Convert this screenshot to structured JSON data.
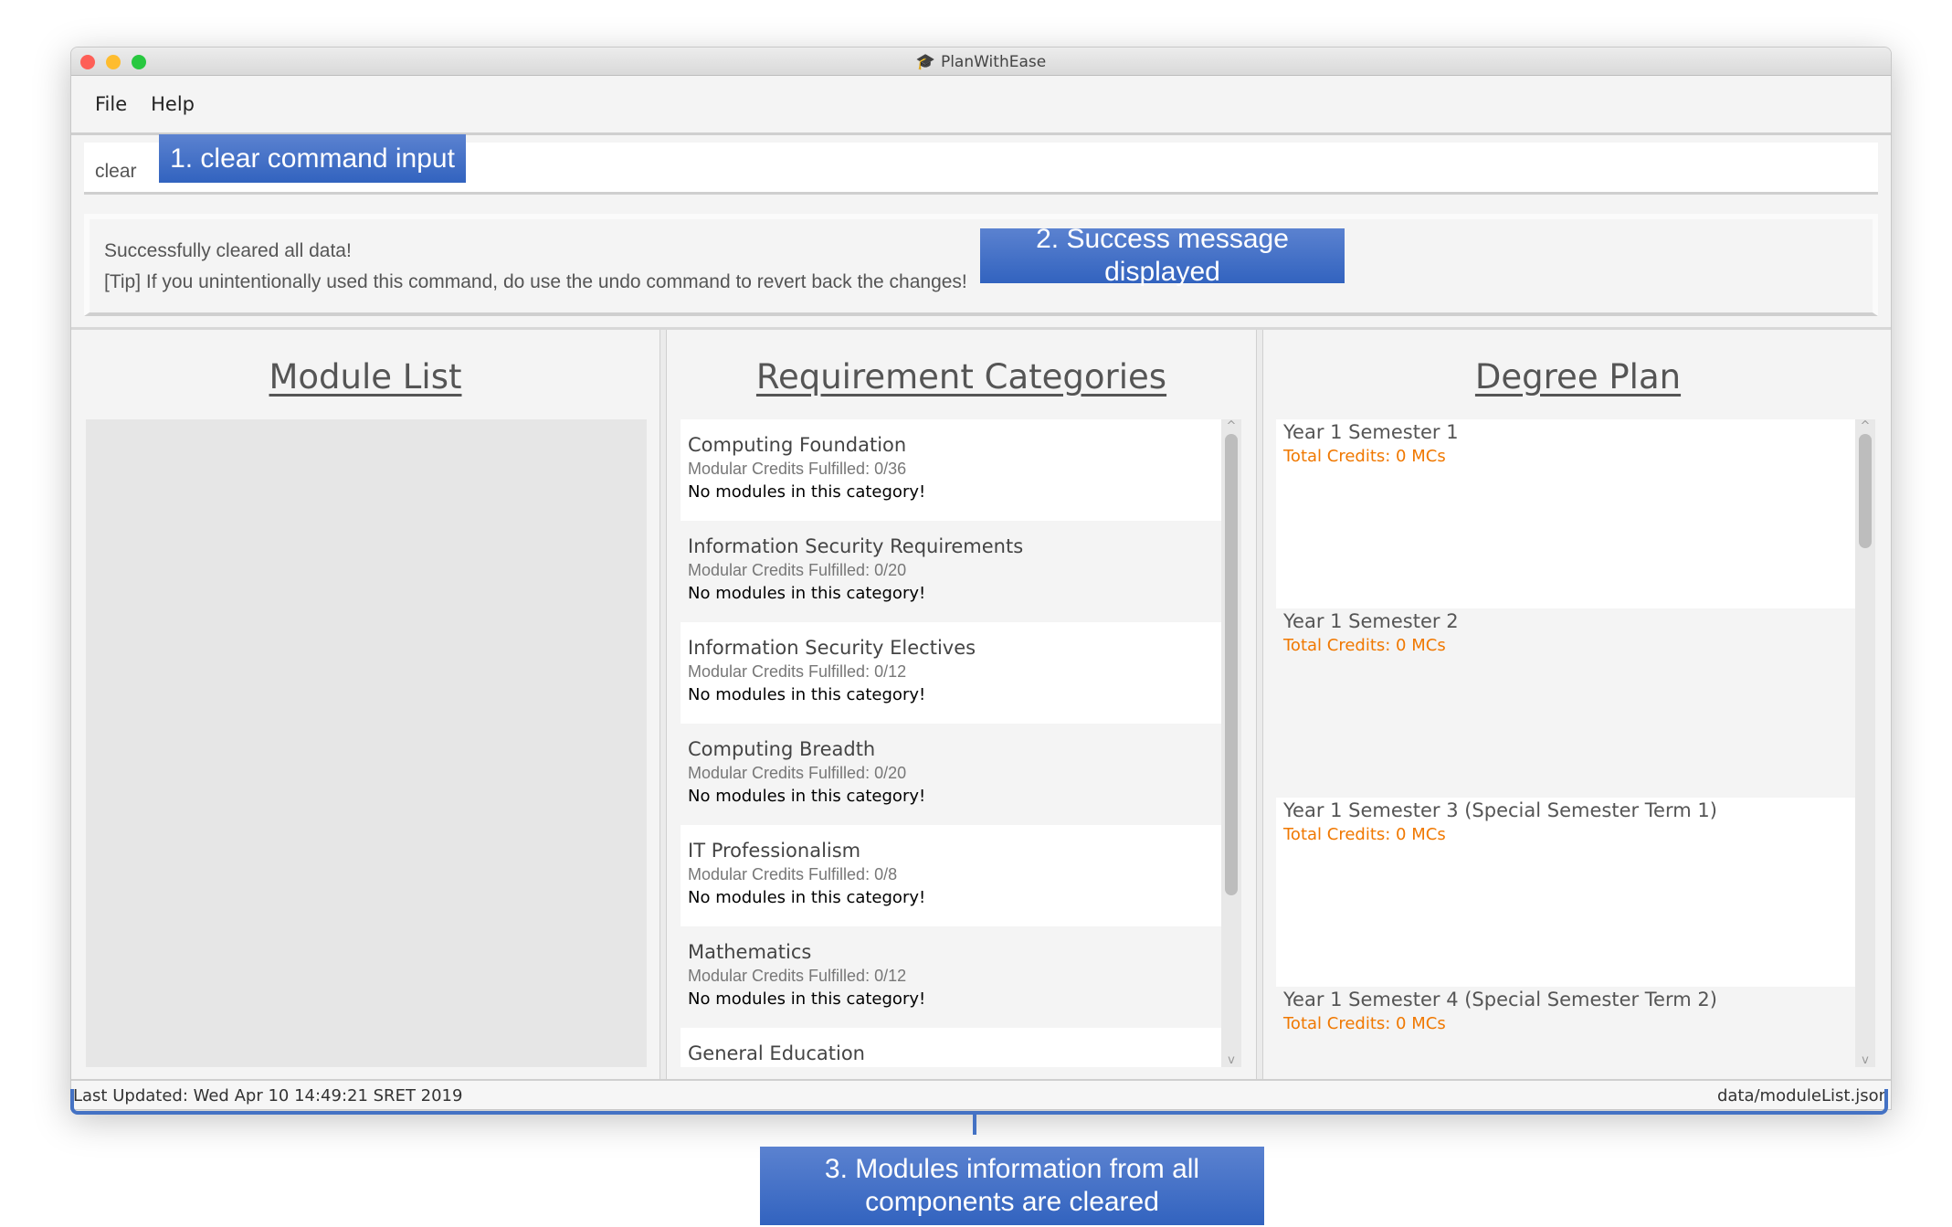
{
  "window": {
    "title": "PlanWithEase",
    "title_icon": "graduation-cap-icon",
    "controls": {
      "close": "#fe5f57",
      "minimize": "#febc2e",
      "zoom": "#28c840"
    }
  },
  "menu": [
    "File",
    "Help"
  ],
  "command": {
    "value": "clear"
  },
  "result": {
    "lines": [
      "Successfully cleared all data!",
      "[Tip] If you unintentionally used this command, do use the undo command to revert back the changes!"
    ]
  },
  "panels": {
    "module_list": {
      "title": "Module List"
    },
    "requirements": {
      "title": "Requirement Categories",
      "items": [
        {
          "name": "Computing Foundation",
          "credits": "Modular Credits Fulfilled: 0/36",
          "modules": "No modules in this category!"
        },
        {
          "name": "Information Security Requirements",
          "credits": "Modular Credits Fulfilled: 0/20",
          "modules": "No modules in this category!"
        },
        {
          "name": "Information Security Electives",
          "credits": "Modular Credits Fulfilled: 0/12",
          "modules": "No modules in this category!"
        },
        {
          "name": "Computing Breadth",
          "credits": "Modular Credits Fulfilled: 0/20",
          "modules": "No modules in this category!"
        },
        {
          "name": "IT Professionalism",
          "credits": "Modular Credits Fulfilled: 0/8",
          "modules": "No modules in this category!"
        },
        {
          "name": "Mathematics",
          "credits": "Modular Credits Fulfilled: 0/12",
          "modules": "No modules in this category!"
        },
        {
          "name": "General Education",
          "credits": "",
          "modules": ""
        }
      ]
    },
    "degree_plan": {
      "title": "Degree Plan",
      "items": [
        {
          "name": "Year 1 Semester 1",
          "credits": "Total Credits: 0 MCs"
        },
        {
          "name": "Year 1 Semester 2",
          "credits": "Total Credits: 0 MCs"
        },
        {
          "name": "Year 1 Semester 3 (Special Semester Term 1)",
          "credits": "Total Credits: 0 MCs"
        },
        {
          "name": "Year 1 Semester 4 (Special Semester Term 2)",
          "credits": "Total Credits: 0 MCs"
        }
      ]
    }
  },
  "status": {
    "left": "Last Updated: Wed Apr 10 14:49:21 SRET 2019",
    "right": "data/moduleList.json"
  },
  "annotations": [
    "1. clear command input",
    "2. Success message displayed",
    "3. Modules information from all components are cleared"
  ],
  "colors": {
    "annotation": "#3f6fc8",
    "credits": "#f07800"
  }
}
